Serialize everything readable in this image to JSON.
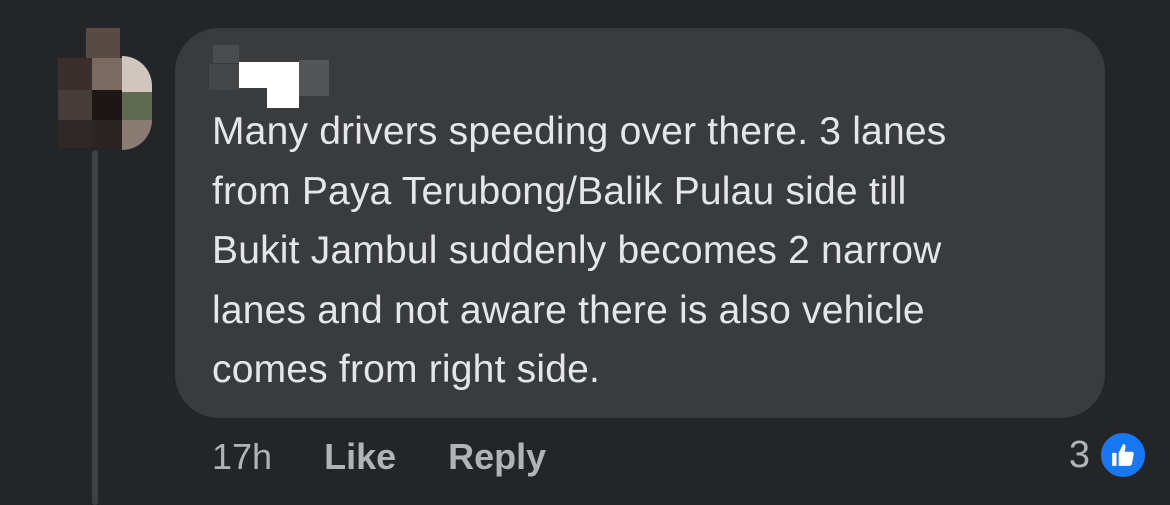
{
  "comment": {
    "author_redacted": true,
    "text_lines": [
      "Many drivers speeding over there. 3 lanes",
      "from Paya Terubong/Balik Pulau side till",
      "Bukit Jambul suddenly becomes 2 narrow",
      "lanes and not aware there is also vehicle",
      "comes from right side."
    ],
    "time": "17h",
    "like_label": "Like",
    "reply_label": "Reply",
    "reaction_count": "3",
    "reaction_icon": "thumbs-up-icon"
  },
  "colors": {
    "background": "#242526",
    "bubble": "#3a3b3c",
    "text": "#e4e6eb",
    "secondary_text": "#b0b3b8",
    "like_blue": "#1877f2"
  }
}
